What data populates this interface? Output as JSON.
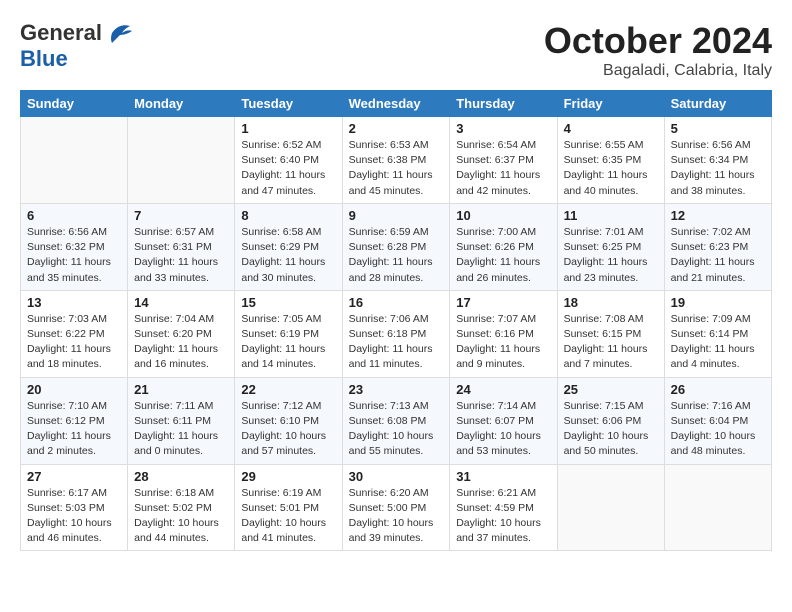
{
  "header": {
    "logo_general": "General",
    "logo_blue": "Blue",
    "title": "October 2024",
    "location": "Bagaladi, Calabria, Italy"
  },
  "weekdays": [
    "Sunday",
    "Monday",
    "Tuesday",
    "Wednesday",
    "Thursday",
    "Friday",
    "Saturday"
  ],
  "weeks": [
    [
      {
        "day": "",
        "info": ""
      },
      {
        "day": "",
        "info": ""
      },
      {
        "day": "1",
        "info": "Sunrise: 6:52 AM\nSunset: 6:40 PM\nDaylight: 11 hours and 47 minutes."
      },
      {
        "day": "2",
        "info": "Sunrise: 6:53 AM\nSunset: 6:38 PM\nDaylight: 11 hours and 45 minutes."
      },
      {
        "day": "3",
        "info": "Sunrise: 6:54 AM\nSunset: 6:37 PM\nDaylight: 11 hours and 42 minutes."
      },
      {
        "day": "4",
        "info": "Sunrise: 6:55 AM\nSunset: 6:35 PM\nDaylight: 11 hours and 40 minutes."
      },
      {
        "day": "5",
        "info": "Sunrise: 6:56 AM\nSunset: 6:34 PM\nDaylight: 11 hours and 38 minutes."
      }
    ],
    [
      {
        "day": "6",
        "info": "Sunrise: 6:56 AM\nSunset: 6:32 PM\nDaylight: 11 hours and 35 minutes."
      },
      {
        "day": "7",
        "info": "Sunrise: 6:57 AM\nSunset: 6:31 PM\nDaylight: 11 hours and 33 minutes."
      },
      {
        "day": "8",
        "info": "Sunrise: 6:58 AM\nSunset: 6:29 PM\nDaylight: 11 hours and 30 minutes."
      },
      {
        "day": "9",
        "info": "Sunrise: 6:59 AM\nSunset: 6:28 PM\nDaylight: 11 hours and 28 minutes."
      },
      {
        "day": "10",
        "info": "Sunrise: 7:00 AM\nSunset: 6:26 PM\nDaylight: 11 hours and 26 minutes."
      },
      {
        "day": "11",
        "info": "Sunrise: 7:01 AM\nSunset: 6:25 PM\nDaylight: 11 hours and 23 minutes."
      },
      {
        "day": "12",
        "info": "Sunrise: 7:02 AM\nSunset: 6:23 PM\nDaylight: 11 hours and 21 minutes."
      }
    ],
    [
      {
        "day": "13",
        "info": "Sunrise: 7:03 AM\nSunset: 6:22 PM\nDaylight: 11 hours and 18 minutes."
      },
      {
        "day": "14",
        "info": "Sunrise: 7:04 AM\nSunset: 6:20 PM\nDaylight: 11 hours and 16 minutes."
      },
      {
        "day": "15",
        "info": "Sunrise: 7:05 AM\nSunset: 6:19 PM\nDaylight: 11 hours and 14 minutes."
      },
      {
        "day": "16",
        "info": "Sunrise: 7:06 AM\nSunset: 6:18 PM\nDaylight: 11 hours and 11 minutes."
      },
      {
        "day": "17",
        "info": "Sunrise: 7:07 AM\nSunset: 6:16 PM\nDaylight: 11 hours and 9 minutes."
      },
      {
        "day": "18",
        "info": "Sunrise: 7:08 AM\nSunset: 6:15 PM\nDaylight: 11 hours and 7 minutes."
      },
      {
        "day": "19",
        "info": "Sunrise: 7:09 AM\nSunset: 6:14 PM\nDaylight: 11 hours and 4 minutes."
      }
    ],
    [
      {
        "day": "20",
        "info": "Sunrise: 7:10 AM\nSunset: 6:12 PM\nDaylight: 11 hours and 2 minutes."
      },
      {
        "day": "21",
        "info": "Sunrise: 7:11 AM\nSunset: 6:11 PM\nDaylight: 11 hours and 0 minutes."
      },
      {
        "day": "22",
        "info": "Sunrise: 7:12 AM\nSunset: 6:10 PM\nDaylight: 10 hours and 57 minutes."
      },
      {
        "day": "23",
        "info": "Sunrise: 7:13 AM\nSunset: 6:08 PM\nDaylight: 10 hours and 55 minutes."
      },
      {
        "day": "24",
        "info": "Sunrise: 7:14 AM\nSunset: 6:07 PM\nDaylight: 10 hours and 53 minutes."
      },
      {
        "day": "25",
        "info": "Sunrise: 7:15 AM\nSunset: 6:06 PM\nDaylight: 10 hours and 50 minutes."
      },
      {
        "day": "26",
        "info": "Sunrise: 7:16 AM\nSunset: 6:04 PM\nDaylight: 10 hours and 48 minutes."
      }
    ],
    [
      {
        "day": "27",
        "info": "Sunrise: 6:17 AM\nSunset: 5:03 PM\nDaylight: 10 hours and 46 minutes."
      },
      {
        "day": "28",
        "info": "Sunrise: 6:18 AM\nSunset: 5:02 PM\nDaylight: 10 hours and 44 minutes."
      },
      {
        "day": "29",
        "info": "Sunrise: 6:19 AM\nSunset: 5:01 PM\nDaylight: 10 hours and 41 minutes."
      },
      {
        "day": "30",
        "info": "Sunrise: 6:20 AM\nSunset: 5:00 PM\nDaylight: 10 hours and 39 minutes."
      },
      {
        "day": "31",
        "info": "Sunrise: 6:21 AM\nSunset: 4:59 PM\nDaylight: 10 hours and 37 minutes."
      },
      {
        "day": "",
        "info": ""
      },
      {
        "day": "",
        "info": ""
      }
    ]
  ]
}
